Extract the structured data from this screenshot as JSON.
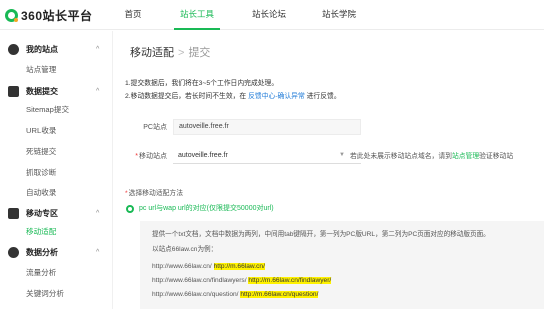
{
  "logo": {
    "text": "360站长平台"
  },
  "nav": {
    "items": [
      "首页",
      "站长工具",
      "站长论坛",
      "站长学院"
    ],
    "active": "站长工具"
  },
  "sidebar": {
    "groups": [
      {
        "label": "我的站点",
        "icon": "user-icon",
        "items": [
          "站点管理"
        ]
      },
      {
        "label": "数据提交",
        "icon": "bar-chart-icon",
        "items": [
          "Sitemap提交",
          "URL收录",
          "死链提交",
          "抓取诊断",
          "自动收录"
        ]
      },
      {
        "label": "移动专区",
        "icon": "mobile-icon",
        "items": [
          "移动适配"
        ]
      },
      {
        "label": "数据分析",
        "icon": "pie-chart-icon",
        "items": [
          "流量分析",
          "关键词分析"
        ]
      }
    ],
    "active_item": "移动适配"
  },
  "breadcrumb": {
    "section": "移动适配",
    "sep": ">",
    "current": "提交"
  },
  "notes": {
    "line1": "1.提交数据后，我们将在3~5个工作日内完成处理。",
    "line2_pre": "2.移动数据提交后，若长时间不生效，在",
    "line2_link": "反馈中心-确认异常",
    "line2_post": "进行反馈。"
  },
  "form": {
    "pc_label": "PC站点",
    "pc_value": "autoveille.free.fr",
    "mobile_label": "移动站点",
    "mobile_value": "autoveille.free.fr",
    "mobile_hint_pre": "若此处未展示移动站点域名，请到",
    "mobile_hint_link": "站点管理",
    "mobile_hint_post": "验证移动站"
  },
  "method": {
    "title": "选择移动适配方法",
    "option": "pc url与wap url的对应(仅限提交50000对url)"
  },
  "example": {
    "desc": "提供一个txt文档，文档中数据为两列，中间用tab键隔开，第一列为PC版URL，第二列为PC页面对应的移动版页面。",
    "intro": "以站点66law.cn为例：",
    "rows": [
      {
        "pc": "http://www.66law.cn/",
        "mobile": "http://m.66law.cn/"
      },
      {
        "pc": "http://www.66law.cn/findlawyers/",
        "mobile": "http://m.66law.cn/findlawyer/"
      },
      {
        "pc": "http://www.66law.cn/question/",
        "mobile": "http://m.66law.cn/question/"
      }
    ],
    "highlight_color": "#fff200"
  },
  "colors": {
    "brand": "#19b955",
    "link": "#1f7bd8",
    "required": "#e33333"
  }
}
